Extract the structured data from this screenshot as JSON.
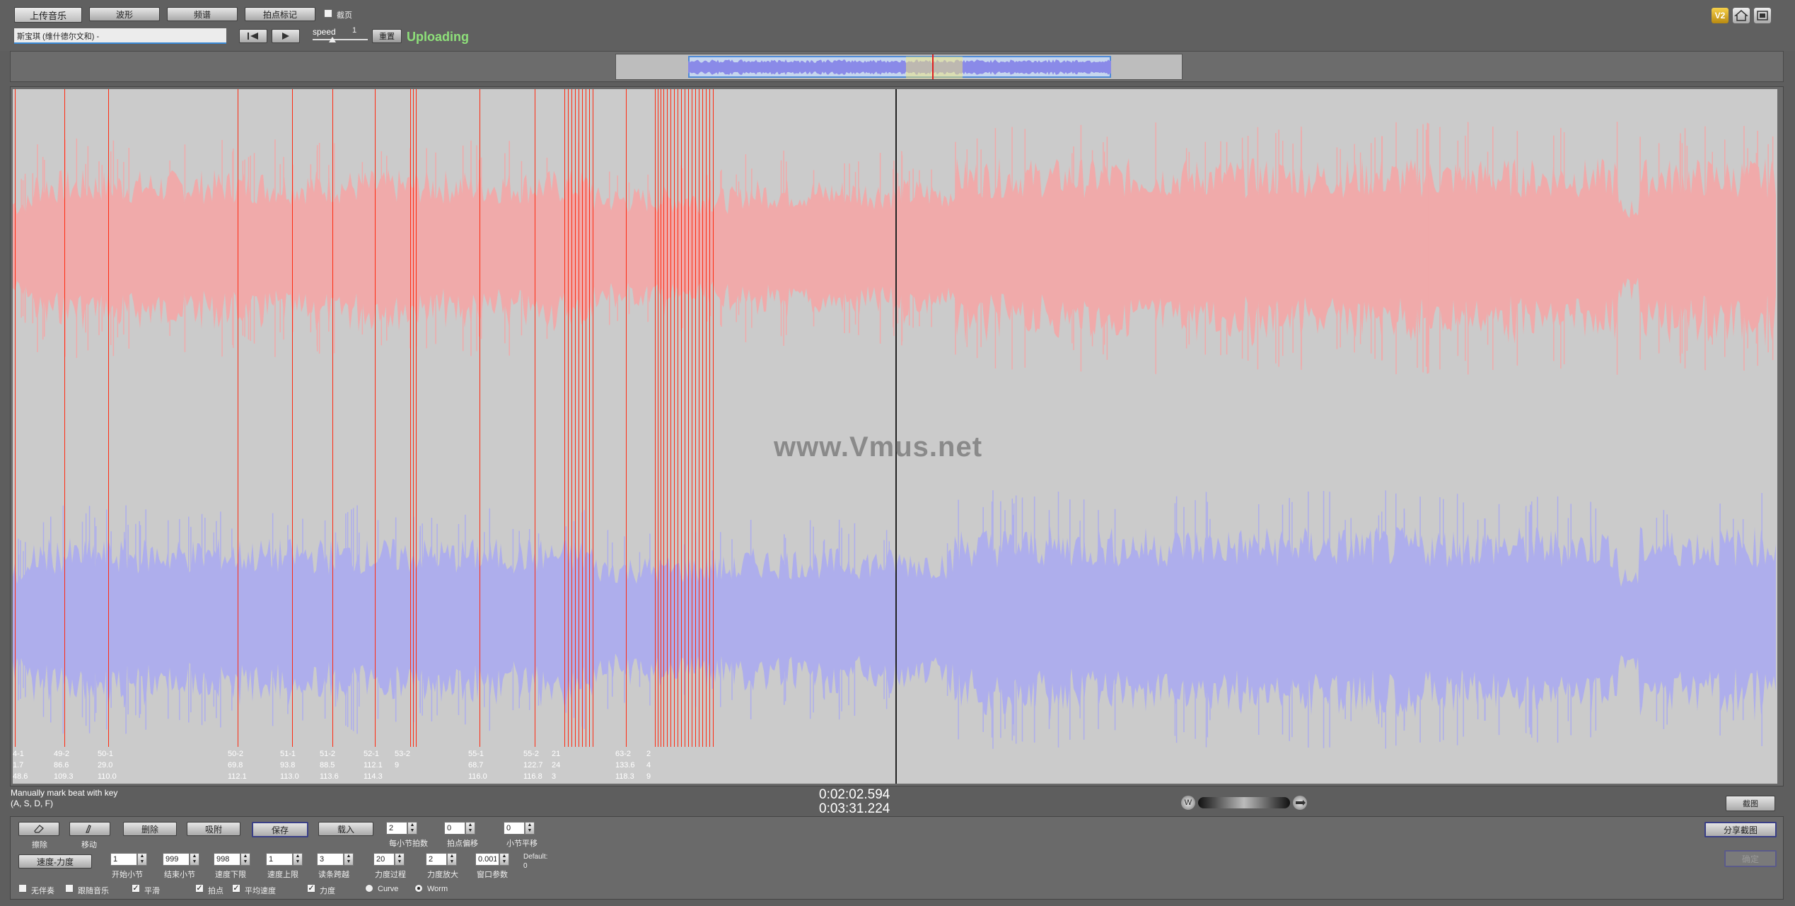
{
  "toolbar": {
    "upload_music": "上传音乐",
    "waveform": "波形",
    "spectrum": "频谱",
    "beat_marks": "拍点标记",
    "checkbox_label": "截页",
    "file_title": "斯宝琪 (维什德尔文和) -",
    "speed_label": "speed",
    "speed_value": "1",
    "reset": "重置",
    "status": "Uploading"
  },
  "watermark": "www.Vmus.net",
  "status_bar": {
    "hint_line1": "Manually mark beat with key",
    "hint_line2": "(A, S, D, F)",
    "current_time": "0:02:02.594",
    "total_time": "0:03:31.224",
    "right_button": "截图"
  },
  "beat_labels": [
    {
      "l1": "4-1",
      "l2": "1.7",
      "l3": "48.6"
    },
    {
      "l1": "49-2",
      "l2": "86.6",
      "l3": "109.3"
    },
    {
      "l1": "50-1",
      "l2": "29.0",
      "l3": "110.0"
    },
    {
      "l1": "50-2",
      "l2": "69.8",
      "l3": "112.1"
    },
    {
      "l1": "51-1",
      "l2": "93.8",
      "l3": "113.0"
    },
    {
      "l1": "51-2",
      "l2": "88.5",
      "l3": "113.6"
    },
    {
      "l1": "52-1",
      "l2": "112.1",
      "l3": "114.3"
    },
    {
      "l1": "53-2",
      "l2": "",
      "l3": "9"
    },
    {
      "l1": "55-1",
      "l2": "68.7",
      "l3": "116.0"
    },
    {
      "l1": "55-2",
      "l2": "122.7",
      "l3": "116.8"
    },
    {
      "l1": "21",
      "l2": "24",
      "l3": "3"
    },
    {
      "l1": "63-2",
      "l2": "133.6",
      "l3": "118.3"
    },
    {
      "l1": "2",
      "l2": "4",
      "l3": "9"
    }
  ],
  "controls": {
    "row1": {
      "erase": "擦除",
      "move": "移动",
      "delete": "删除",
      "adsorb": "吸附",
      "save": "保存",
      "load": "载入",
      "beats_per_bar_value": "2",
      "beats_per_bar_label": "每小节拍数",
      "beat_offset_value": "0",
      "beat_offset_label": "拍点偏移",
      "bar_offset_value": "0",
      "bar_offset_label": "小节平移"
    },
    "row2": {
      "tempo_dynamics": "速度-力度",
      "start_bar_value": "1",
      "start_bar_label": "开始小节",
      "end_bar_value": "999",
      "end_bar_label": "结束小节",
      "tempo_low_value": "998",
      "tempo_low_label": "速度下限",
      "tempo_high_value": "1",
      "tempo_high_label": "速度上限",
      "bar_span_value": "3",
      "bar_span_label": "读条跨越",
      "dyn_smooth_value": "20",
      "dyn_smooth_label": "力度过程",
      "dyn_scale_value": "2",
      "dyn_scale_label": "力度放大",
      "window_param_value": "0.001",
      "window_param_label": "窗口参数",
      "default_label": "Default:",
      "default_value": "0"
    },
    "row3": {
      "no_compare": "无伴奏",
      "follow_music": "跟随音乐",
      "smooth": "平滑",
      "beat_point": "拍点",
      "avg_tempo": "平均速度",
      "dynamics": "力度",
      "curve": "Curve",
      "worm": "Worm"
    },
    "share_button": "分享截图",
    "disabled_button": "确定"
  },
  "colors": {
    "top_channel": "#f0aaaa",
    "bottom_channel": "#aeaeec",
    "beat_line": "#ff2a10",
    "status": "#8ee07a"
  },
  "icons": [
    "v2-badge-icon",
    "home-icon",
    "fullscreen-icon",
    "prev-icon",
    "play-icon",
    "zoom-out-icon",
    "zoom-in-icon"
  ]
}
